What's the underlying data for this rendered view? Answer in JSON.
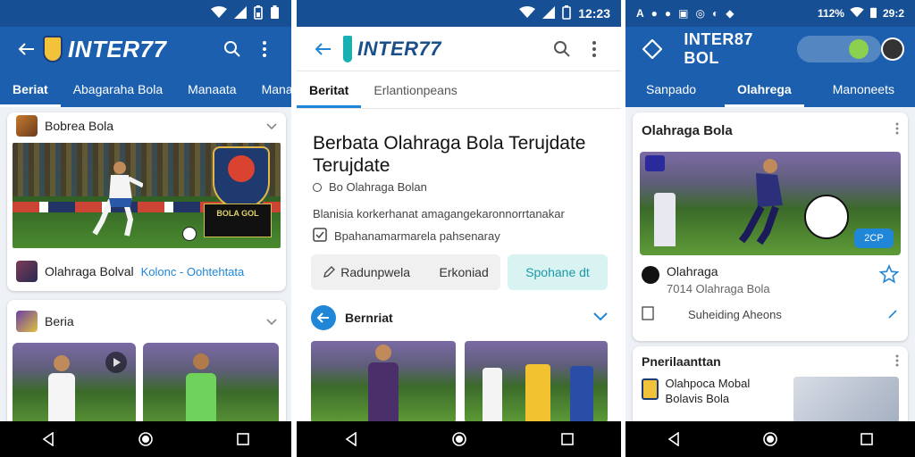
{
  "colors": {
    "primary": "#1b5fae",
    "accent": "#1f86d8",
    "light_accent_bg": "#d9f2f2"
  },
  "phone1": {
    "app_name": "INTER77",
    "tabs": [
      "Beriat",
      "Abagaraha Bola",
      "Manaata",
      "Mana"
    ],
    "card1": {
      "title": "Bobrea Bola",
      "image_badge": "BOLA GOL",
      "footer_text": "Olahraga Bolval",
      "footer_link": "Kolonc - Oohtehtata"
    },
    "card2": {
      "title": "Beria"
    }
  },
  "phone2": {
    "status_time": "12:23",
    "app_name": "INTER77",
    "tabs": [
      "Beritat",
      "Erlantionpeans"
    ],
    "headline": "Berbata Olahraga Bola Terujdate Terujdate",
    "source": "Bo Olahraga Bolan",
    "summary": "Blanisia korkerhanat amagangekaronnorrtanakar",
    "meta": "Bpahanamarmarela pahsenaray",
    "btn_left": "Radunpwela",
    "btn_mid": "Erkoniad",
    "btn_right": "Spohane dt",
    "section_title": "Bernriat"
  },
  "phone3": {
    "status_time": "112%",
    "status_clock": "29:2",
    "app_name": "INTER87 BOL",
    "tabs": [
      "Sanpado",
      "Olahrega",
      "Manoneets"
    ],
    "card1": {
      "title": "Olahraga Bola",
      "score_chip": "2CP",
      "item_title": "Olahraga",
      "item_sub": "7014 Olahraga Bola",
      "action_text": "Suheiding Aheons"
    },
    "card2": {
      "title": "Pnerilaanttan",
      "item_title": "Olahpoca Mobal",
      "item_sub": "Bolavis Bola"
    }
  }
}
